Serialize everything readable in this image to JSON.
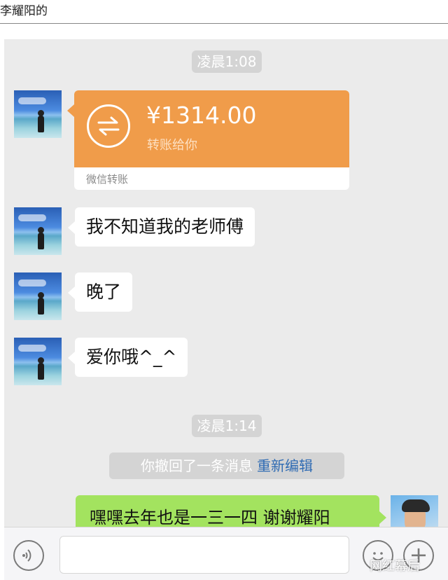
{
  "caption": "李耀阳的",
  "timestamps": [
    "凌晨1:08",
    "凌晨1:14"
  ],
  "transfer": {
    "amount": "¥1314.00",
    "subtitle": "转账给你",
    "footer": "微信转账"
  },
  "messages": [
    {
      "from": "other",
      "text": "我不知道我的老师傅"
    },
    {
      "from": "other",
      "text": "晚了"
    },
    {
      "from": "other",
      "text": "爱你哦^_^"
    }
  ],
  "recall": {
    "text": "你撤回了一条消息",
    "link": "重新编辑"
  },
  "my_message": "嘿嘿去年也是一三一四 谢谢耀阳",
  "watermark": "网红幕后",
  "colors": {
    "transfer_orange": "#f09c4a",
    "my_bubble_green": "#a3e35f",
    "link_blue": "#2f6bb3",
    "chat_background": "#ebebeb"
  },
  "icons": [
    "transfer-arrows-icon",
    "voice-icon",
    "emoji-icon",
    "plus-icon"
  ]
}
